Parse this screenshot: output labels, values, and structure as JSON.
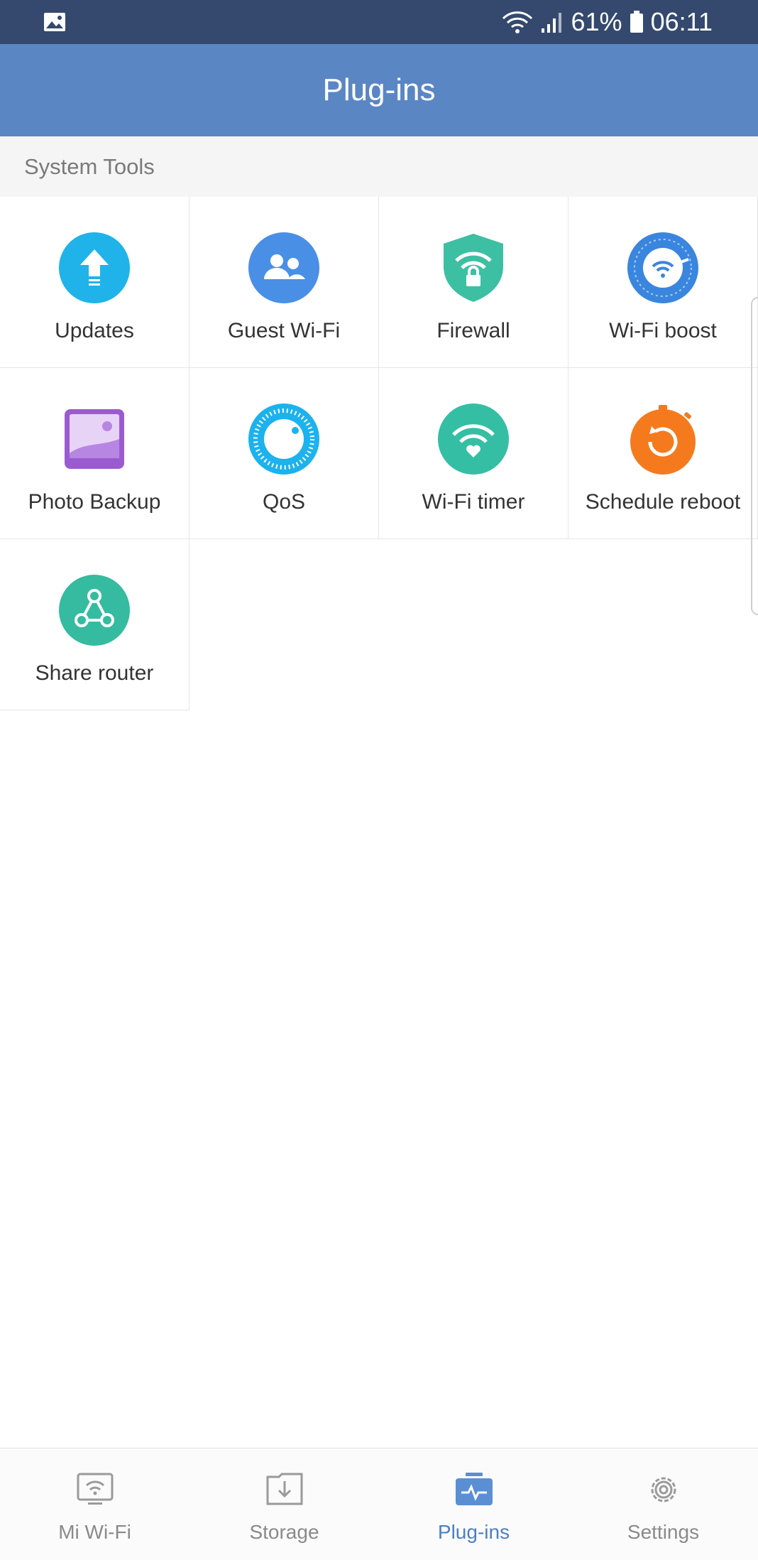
{
  "status_bar": {
    "left_icon": "image-icon",
    "battery": "61%",
    "time": "06:11"
  },
  "app_bar": {
    "title": "Plug-ins"
  },
  "section": {
    "title": "System Tools"
  },
  "plugins": [
    {
      "label": "Updates",
      "icon": "update-arrow-icon",
      "color": "#1fb3ea"
    },
    {
      "label": "Guest Wi-Fi",
      "icon": "guest-users-icon",
      "color": "#4a8fe6"
    },
    {
      "label": "Firewall",
      "icon": "shield-lock-icon",
      "color": "#3dbfa3"
    },
    {
      "label": "Wi-Fi boost",
      "icon": "wifi-boost-icon",
      "color": "#3a86de"
    },
    {
      "label": "Photo Backup",
      "icon": "photo-icon",
      "color": "#9a5bd1"
    },
    {
      "label": "QoS",
      "icon": "qos-dial-icon",
      "color": "#1cb2ee"
    },
    {
      "label": "Wi-Fi timer",
      "icon": "wifi-timer-icon",
      "color": "#34bfa4"
    },
    {
      "label": "Schedule reboot",
      "icon": "reboot-timer-icon",
      "color": "#f57a1d"
    },
    {
      "label": "Share router",
      "icon": "share-icon",
      "color": "#35bba0"
    }
  ],
  "bottom_nav": {
    "items": [
      {
        "label": "Mi Wi-Fi",
        "icon": "router-wifi-icon"
      },
      {
        "label": "Storage",
        "icon": "storage-download-icon"
      },
      {
        "label": "Plug-ins",
        "icon": "plugins-icon"
      },
      {
        "label": "Settings",
        "icon": "gear-icon"
      }
    ],
    "active_color": "#4d7fc4"
  }
}
